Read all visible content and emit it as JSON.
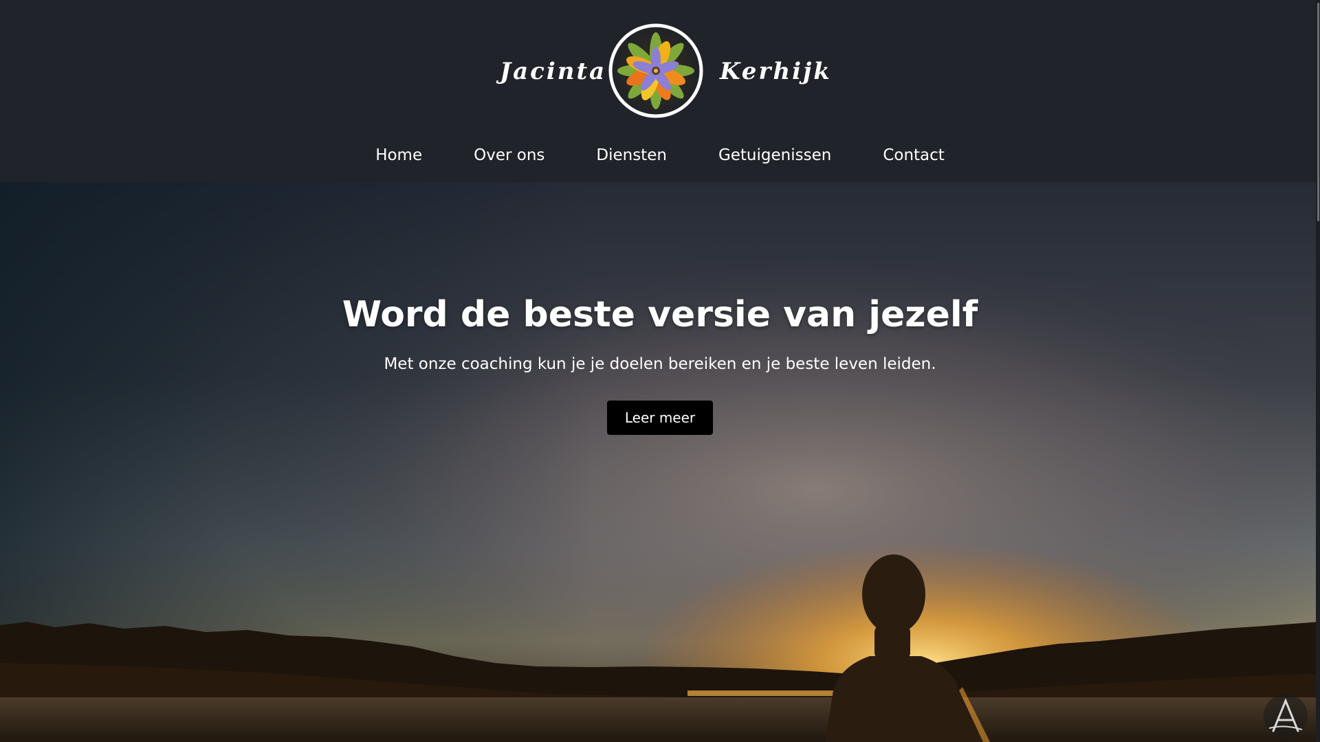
{
  "brand": {
    "first_name": "Jacinta",
    "last_name": "Kerhijk",
    "logo_icon": "flower-mandala-icon"
  },
  "nav": {
    "items": [
      {
        "label": "Home"
      },
      {
        "label": "Over ons"
      },
      {
        "label": "Diensten"
      },
      {
        "label": "Getuigenissen"
      },
      {
        "label": "Contact"
      }
    ]
  },
  "hero": {
    "title": "Word de beste versie van jezelf",
    "subtitle": "Met onze coaching kun je je doelen bereiken en je beste leven leiden.",
    "cta_label": "Leer meer",
    "background_image": "silhouette-at-lake-sunset"
  },
  "colors": {
    "header_bg": "#20232a",
    "text": "#ffffff",
    "button_bg": "#000000",
    "sunset_orange": "#f0a030"
  },
  "corner_badge_icon": "letter-a-logo-icon"
}
